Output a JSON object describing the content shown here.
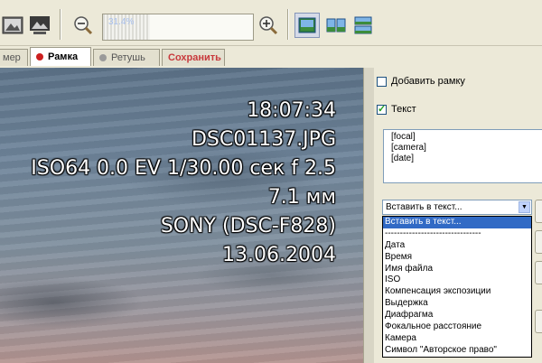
{
  "toolbar": {
    "zoom_value": "31.4%",
    "zoom_fraction": 0.314,
    "icons": [
      "photo-icon",
      "photo-landscape-icon",
      "zoom-out-icon",
      "zoom-in-icon",
      "view-single-icon",
      "view-compare-icon",
      "view-split-icon"
    ]
  },
  "tabs": [
    {
      "label": "мер",
      "active": false
    },
    {
      "label": "Рамка",
      "active": true,
      "dot_color": "#cc1f1f"
    },
    {
      "label": "Ретушь",
      "active": false,
      "dot_color": "#9a9a9a"
    },
    {
      "label": "Сохранить",
      "active": false,
      "accent": "#c8393c"
    }
  ],
  "overlay": {
    "lines": [
      "18:07:34",
      "DSC01137.JPG",
      "ISO64 0.0 EV 1/30.00 сек f 2.5",
      "7.1 мм",
      "SONY (DSC-F828)",
      "13.06.2004"
    ]
  },
  "panel": {
    "add_frame_label": "Добавить рамку",
    "add_frame_checked": false,
    "text_label": "Текст",
    "text_checked": true,
    "template_lines": [
      "[focal]",
      "[camera]",
      "[date]"
    ],
    "insert_select_value": "Вставить в текст...",
    "insert_options": [
      "Вставить в текст...",
      "--------------------------------",
      "Дата",
      "Время",
      "Имя файла",
      "ISO",
      "Компенсация экспозиции",
      "Выдержка",
      "Диафрагма",
      "Фокальное расстояние",
      "Камера",
      "Символ \"Авторское право\""
    ],
    "selected_option_index": 0
  }
}
